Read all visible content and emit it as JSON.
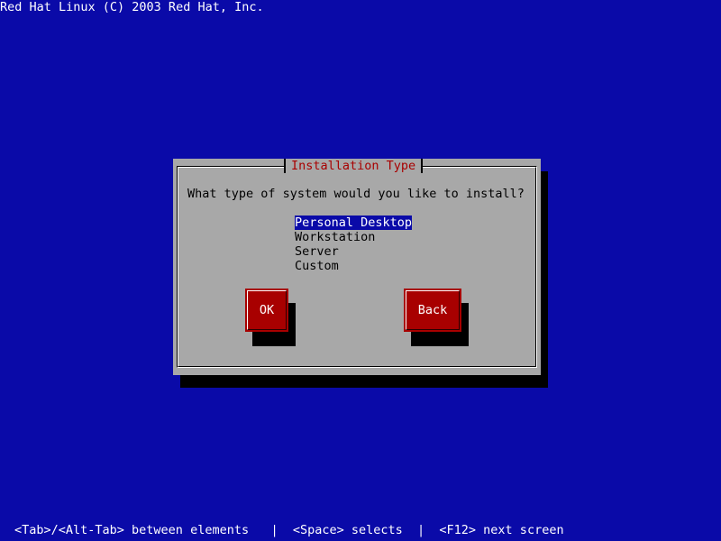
{
  "top_banner": "Red Hat Linux (C) 2003 Red Hat, Inc.",
  "dialog": {
    "title": "Installation Type",
    "question": "What type of system would you like to install?",
    "options": [
      {
        "label": "Personal Desktop",
        "selected": true
      },
      {
        "label": "Workstation",
        "selected": false
      },
      {
        "label": "Server",
        "selected": false
      },
      {
        "label": "Custom",
        "selected": false
      }
    ],
    "ok_label": "OK",
    "back_label": "Back"
  },
  "status_bar": "<Tab>/<Alt-Tab> between elements   |  <Space> selects  |  <F12> next screen",
  "colors": {
    "background": "#0a0aa8",
    "dialog": "#a8a8a8",
    "title_text": "#a80000",
    "button": "#a80000",
    "selection": "#0a0aa8"
  }
}
